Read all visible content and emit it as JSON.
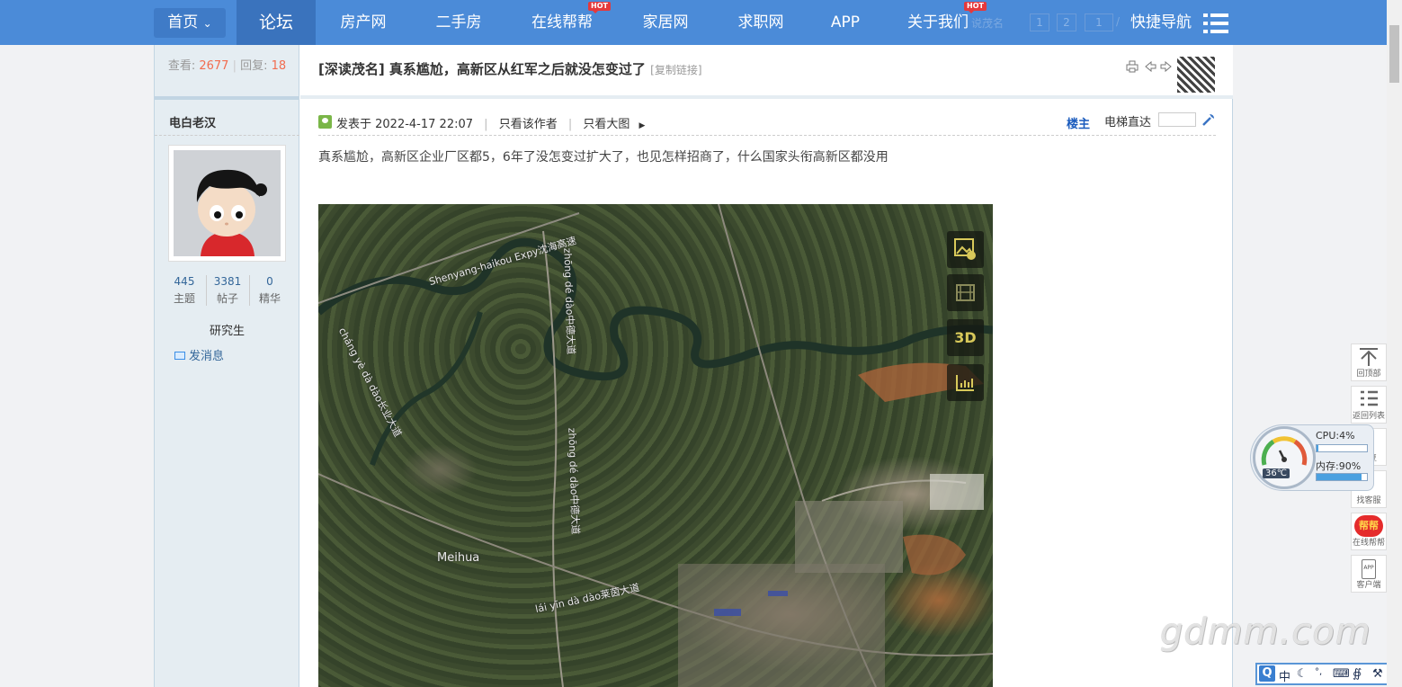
{
  "nav": {
    "home": "首页",
    "forum": "论坛",
    "items": [
      "房产网",
      "二手房",
      "在线帮帮",
      "家居网",
      "求职网",
      "APP",
      "关于我们"
    ],
    "hot_badge": "HOT",
    "quick_nav": "快捷导航",
    "ghost_search": "说茂名",
    "ghost_pages": [
      "1",
      "2",
      "1",
      "/"
    ]
  },
  "thread": {
    "views_label": "查看:",
    "views": "2677",
    "replies_label": "回复:",
    "replies": "18",
    "title": "[深读茂名] 真系尴尬，高新区从红军之后就没怎变过了",
    "copy_link": "[复制链接]"
  },
  "author": {
    "name": "电白老汉",
    "stats": [
      {
        "value": "445",
        "label": "主题"
      },
      {
        "value": "3381",
        "label": "帖子"
      },
      {
        "value": "0",
        "label": "精华"
      }
    ],
    "rank": "研究生",
    "message": "发消息"
  },
  "post": {
    "posted_at": "发表于 2022-4-17 22:07",
    "only_author": "只看该作者",
    "only_image": "只看大图",
    "floor": "楼主",
    "elevator": "电梯直达",
    "body": "真系尴尬，高新区企业厂区都5，6年了没怎变过扩大了，也见怎样招商了，什么国家头衔高新区都没用"
  },
  "map": {
    "labels": [
      "Shenyang-haikou Expy沈海高速",
      "zhōng dé dào中德大道",
      "zhōng dé dào中德大道",
      "cháng yè dà dào长业大道",
      "Meihua",
      "lái yīn dà dào莱茵大道"
    ],
    "tools": [
      "image-icon",
      "film-icon",
      "3D",
      "chart-icon"
    ]
  },
  "side": {
    "buttons": [
      "回顶部",
      "返回列表",
      "回复",
      "找客服",
      "在线帮帮",
      "客户端"
    ],
    "bangbang": "帮帮",
    "app": "APP"
  },
  "monitor": {
    "cpu": "CPU:4%",
    "cpu_value": 0.04,
    "mem": "内存:90%",
    "mem_value": 0.9,
    "temp": "36℃"
  },
  "watermark": "gdmm.com",
  "ime": "中"
}
